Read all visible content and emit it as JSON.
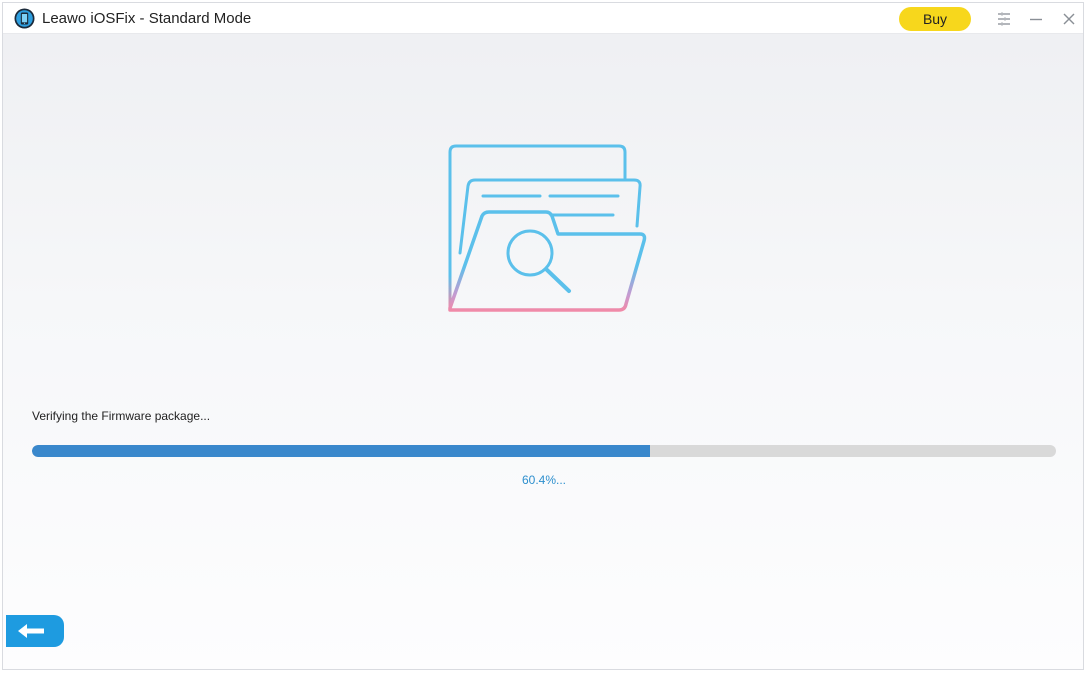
{
  "window": {
    "title": "Leawo iOSFix - Standard Mode",
    "app_icon": "phone-icon"
  },
  "toolbar": {
    "buy_label": "Buy",
    "settings_icon": "settings-list-icon",
    "minimize_icon": "minimize-icon",
    "close_icon": "close-icon"
  },
  "main": {
    "illustration_icon": "folder-search-icon",
    "status_text": "Verifying the Firmware package...",
    "progress": {
      "percent_value": 60.4,
      "percent_label": "60.4%..."
    },
    "back_icon": "arrow-left-icon"
  },
  "colors": {
    "accent_blue": "#1e9be0",
    "progress_fill": "#3a88cc",
    "progress_track": "#d9d9d9",
    "buy_yellow": "#f7d71c",
    "percent_text": "#2d8fce",
    "illustration_blue": "#5bc0eb",
    "illustration_pink": "#f08aa8"
  }
}
